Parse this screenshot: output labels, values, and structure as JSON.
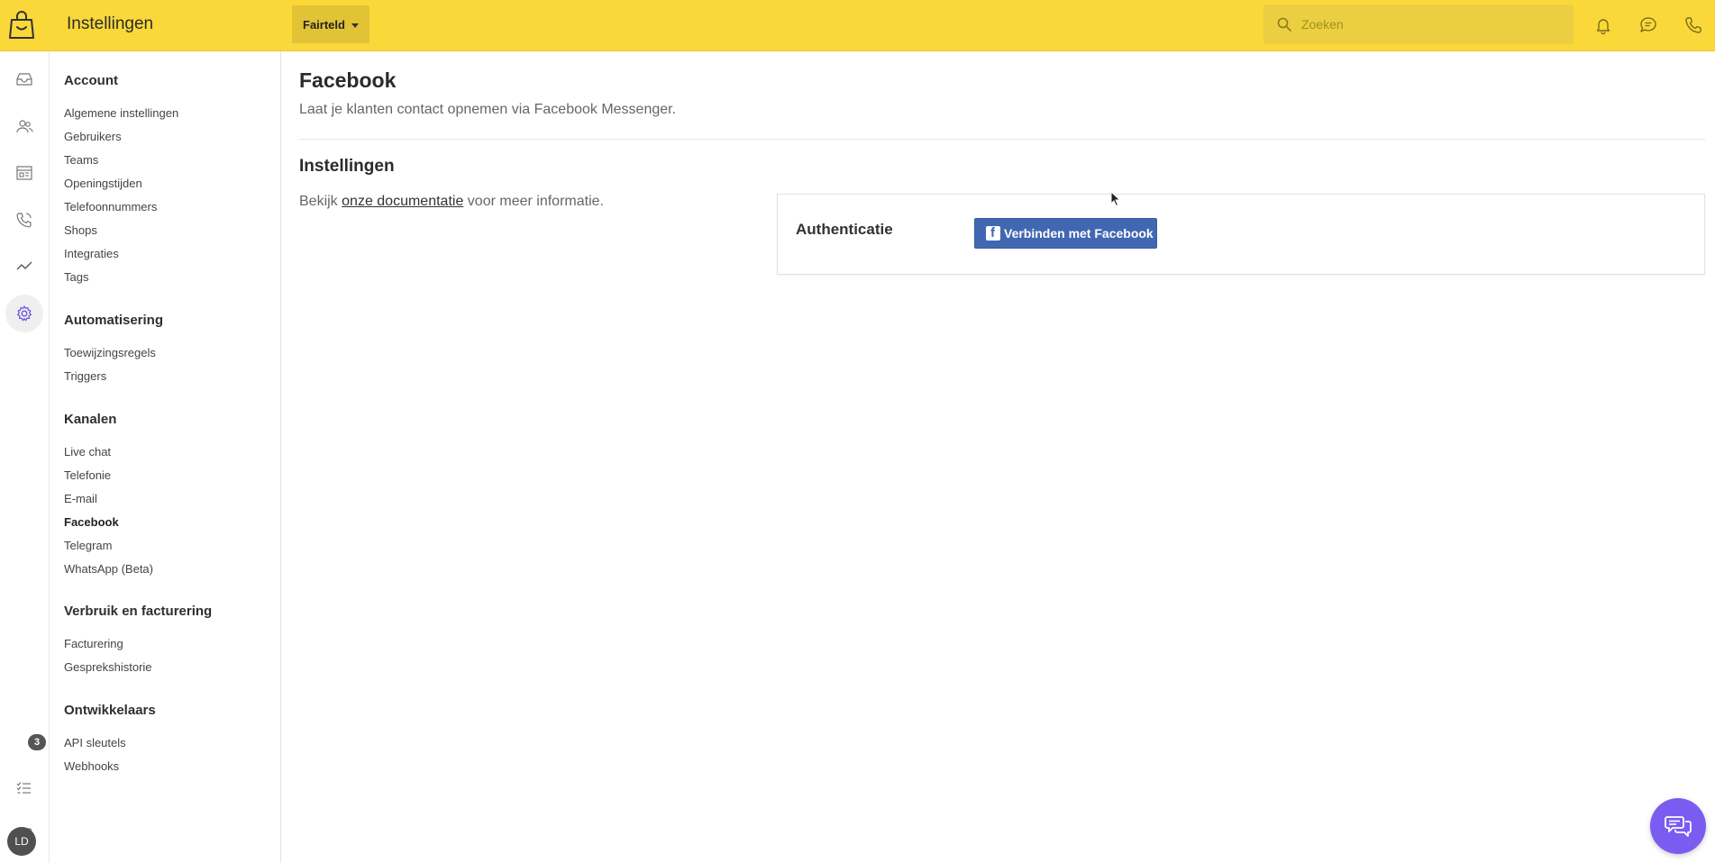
{
  "header": {
    "title": "Instellingen",
    "shop_selector": "Fairteld",
    "search_placeholder": "Zoeken"
  },
  "rail": {
    "badge_count": "3",
    "avatar_initials": "LD"
  },
  "sidebar": {
    "groups": [
      {
        "title": "Account",
        "items": [
          "Algemene instellingen",
          "Gebruikers",
          "Teams",
          "Openingstijden",
          "Telefoonnummers",
          "Shops",
          "Integraties",
          "Tags"
        ]
      },
      {
        "title": "Automatisering",
        "items": [
          "Toewijzingsregels",
          "Triggers"
        ]
      },
      {
        "title": "Kanalen",
        "items": [
          "Live chat",
          "Telefonie",
          "E-mail",
          "Facebook",
          "Telegram",
          "WhatsApp (Beta)"
        ]
      },
      {
        "title": "Verbruik en facturering",
        "items": [
          "Facturering",
          "Gesprekshistorie"
        ]
      },
      {
        "title": "Ontwikkelaars",
        "items": [
          "API sleutels",
          "Webhooks"
        ]
      }
    ],
    "active_item": "Facebook"
  },
  "main": {
    "title": "Facebook",
    "subtitle": "Laat je klanten contact opnemen via Facebook Messenger.",
    "section_title": "Instellingen",
    "doc_prefix": "Bekijk",
    "doc_link": "onze documentatie",
    "doc_suffix": "voor meer informatie.",
    "auth_label": "Authenticatie",
    "connect_button": "Verbinden met Facebook"
  },
  "colors": {
    "topbar": "#fad83a",
    "facebook_button": "#4267b2",
    "chat_launcher": "#7b5cf0"
  }
}
